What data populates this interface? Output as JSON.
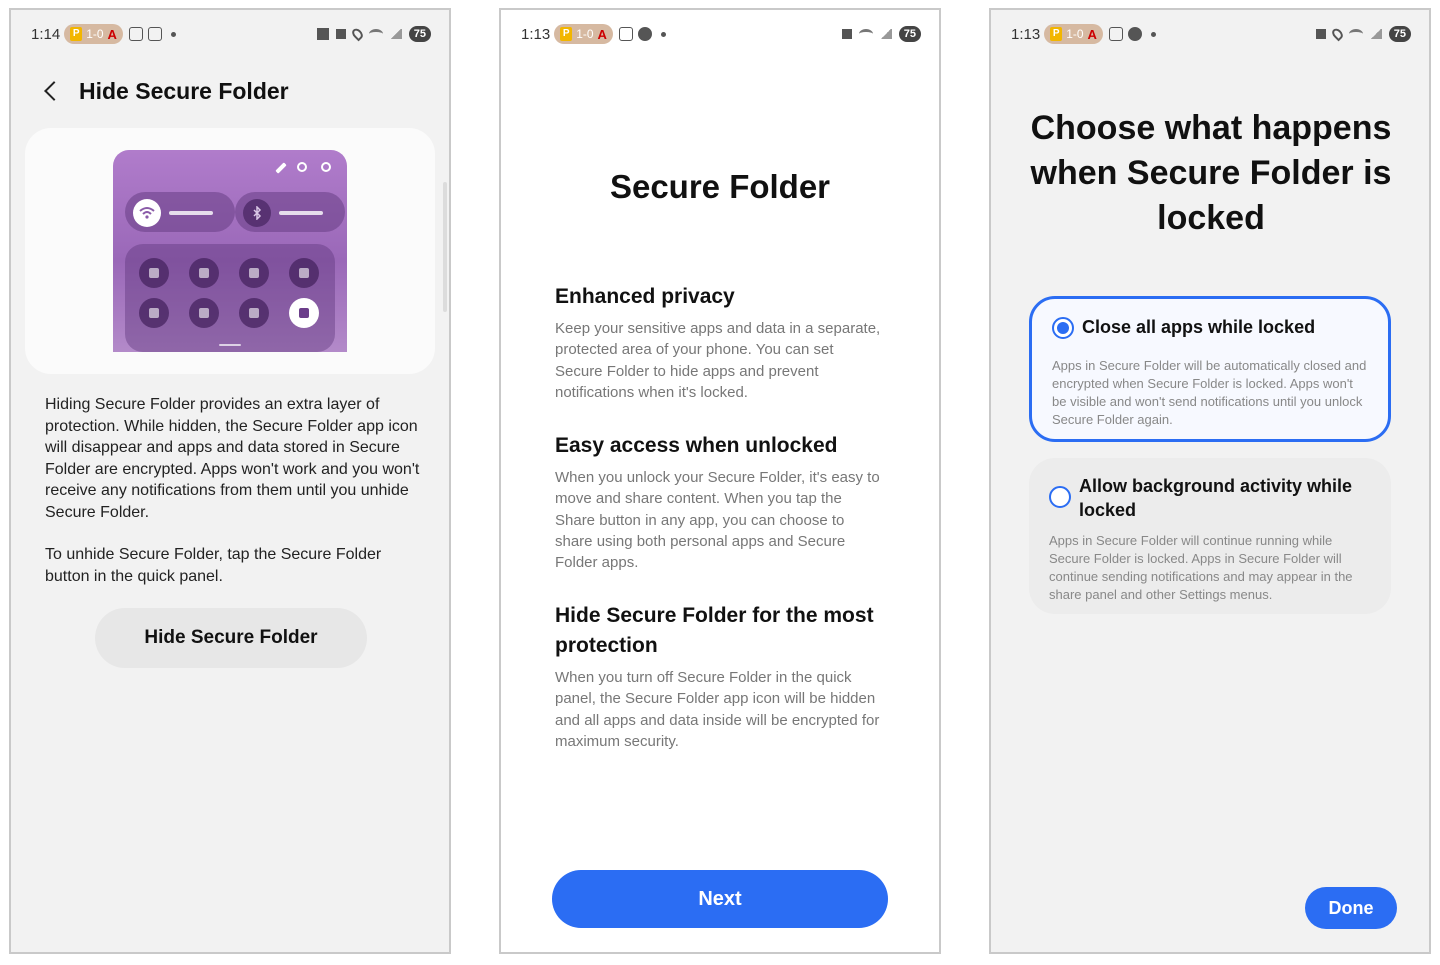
{
  "phone1": {
    "status": {
      "time": "1:14",
      "pill_text": "1-0",
      "pill_p": "P",
      "pill_a": "A",
      "battery": "75"
    },
    "header": {
      "title": "Hide Secure Folder"
    },
    "body": {
      "paragraph1": "Hiding Secure Folder provides an extra layer of protection. While hidden, the Secure Folder app icon will disappear and apps and data stored in Secure Folder are encrypted. Apps won't work and you won't receive any notifications from them until you unhide Secure Folder.",
      "paragraph2": "To unhide Secure Folder, tap the Secure Folder button in the quick panel."
    },
    "hide_button": "Hide Secure Folder"
  },
  "phone2": {
    "status": {
      "time": "1:13",
      "pill_text": "1-0",
      "pill_p": "P",
      "pill_a": "A",
      "battery": "75"
    },
    "title": "Secure Folder",
    "sections": [
      {
        "heading": "Enhanced privacy",
        "text": "Keep your sensitive apps and data in a separate, protected area of your phone. You can set Secure Folder to hide apps and prevent notifications when it's locked."
      },
      {
        "heading": "Easy access when unlocked",
        "text": "When you unlock your Secure Folder, it's easy to move and share content. When you tap the Share button in any app, you can choose to share using both personal apps and Secure Folder apps."
      },
      {
        "heading": "Hide Secure Folder for the most protection",
        "text": "When you turn off Secure Folder in the quick panel, the Secure Folder app icon will be hidden and all apps and data inside will be encrypted for maximum security."
      }
    ],
    "next_button": "Next"
  },
  "phone3": {
    "status": {
      "time": "1:13",
      "pill_text": "1-0",
      "pill_p": "P",
      "pill_a": "A",
      "battery": "75"
    },
    "title": "Choose what happens when Secure Folder is locked",
    "options": [
      {
        "label": "Close all apps while locked",
        "desc": "Apps in Secure Folder will be automatically closed and encrypted when Secure Folder is locked. Apps won't be visible and won't send notifications until you unlock Secure Folder again.",
        "selected": true
      },
      {
        "label": "Allow background activity while locked",
        "desc": "Apps in Secure Folder will continue running while Secure Folder is locked. Apps in Secure Folder will continue sending notifications and may appear in the share panel and other Settings menus.",
        "selected": false
      }
    ],
    "done_button": "Done"
  },
  "colors": {
    "accent": "#2b6df3",
    "panel_purple": "#a874c4"
  }
}
